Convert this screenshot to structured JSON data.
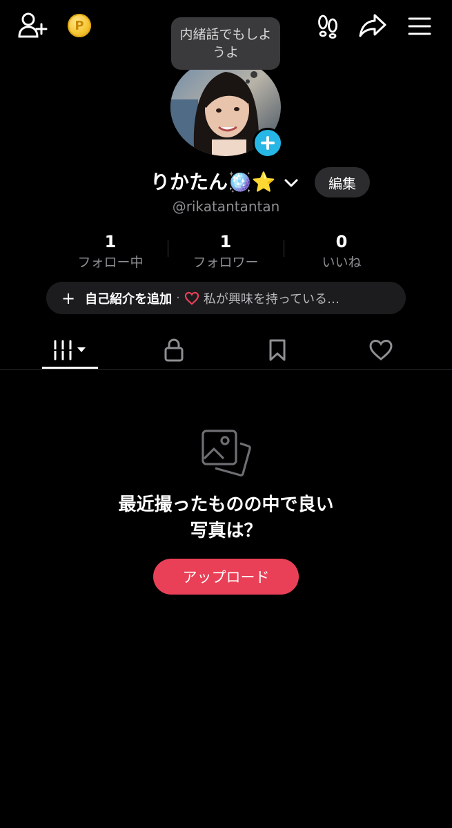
{
  "top_bar": {
    "icons": [
      "add-friend-icon",
      "coin-icon",
      "footprints-icon",
      "share-icon",
      "menu-icon"
    ],
    "coin_letter": "P"
  },
  "bubble": {
    "text": "内緒話でもしようよ"
  },
  "profile": {
    "username": "りかたん🪩⭐️",
    "handle": "@rikatantantan",
    "edit_label": "編集"
  },
  "stats": [
    {
      "value": "1",
      "label": "フォロー中"
    },
    {
      "value": "1",
      "label": "フォロワー"
    },
    {
      "value": "0",
      "label": "いいね"
    }
  ],
  "bio": {
    "add_label": "自己紹介を追加",
    "separator": "·",
    "interest_text": "私が興味を持っている…"
  },
  "tabs": [
    "videos-tab",
    "private-tab",
    "bookmarks-tab",
    "liked-tab"
  ],
  "empty_state": {
    "line1": "最近撮ったものの中で良い",
    "line2": "写真は？",
    "button_label": "アップロード"
  },
  "colors": {
    "accent": "#e94057",
    "avatar_plus": "#27b7e6",
    "heart": "#e94057"
  }
}
